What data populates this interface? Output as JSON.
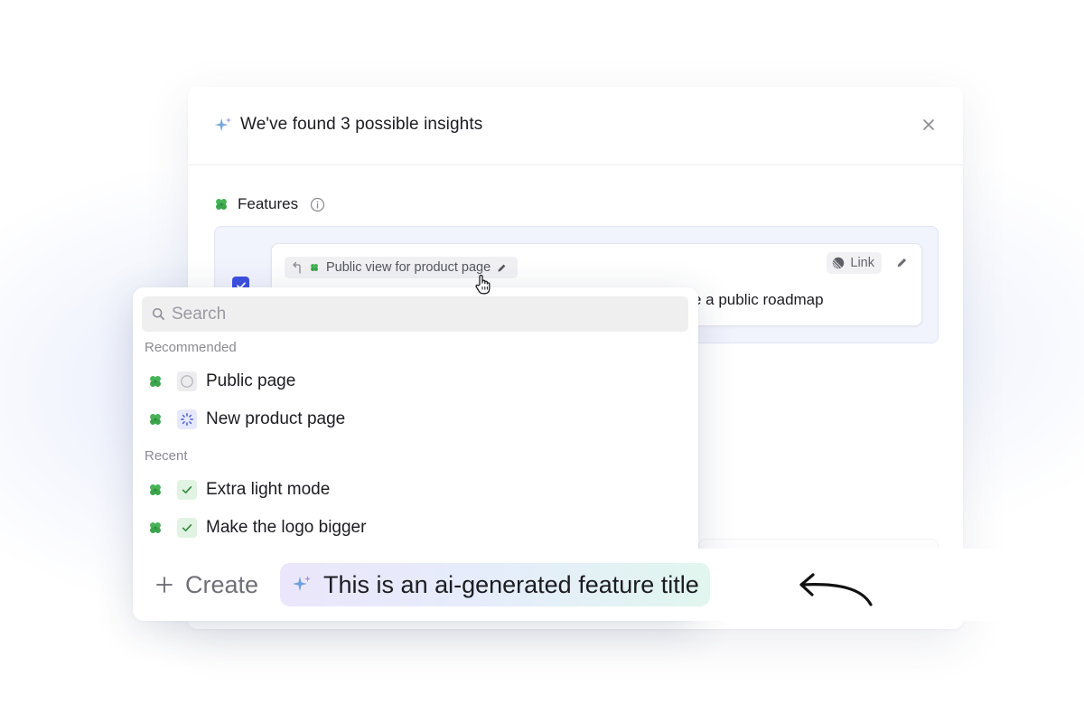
{
  "modal": {
    "title": "We've found 3 possible insights",
    "section_label": "Features"
  },
  "card": {
    "parent_feature": "Public view for product page",
    "link_label": "Link",
    "description": "e a public roadmap"
  },
  "dropdown": {
    "search_placeholder": "Search",
    "recommended_label": "Recommended",
    "recommended": [
      {
        "label": "Public page",
        "status": "todo"
      },
      {
        "label": "New product page",
        "status": "in-progress"
      }
    ],
    "recent_label": "Recent",
    "recent": [
      {
        "label": "Extra light mode",
        "status": "done"
      },
      {
        "label": "Make the logo bigger",
        "status": "done"
      }
    ],
    "create_label": "Create",
    "ai_title": "This is an ai-generated feature title"
  },
  "colors": {
    "accent": "#3c50e0",
    "clover": "#3fb24f",
    "done": "#2f8a3a"
  }
}
